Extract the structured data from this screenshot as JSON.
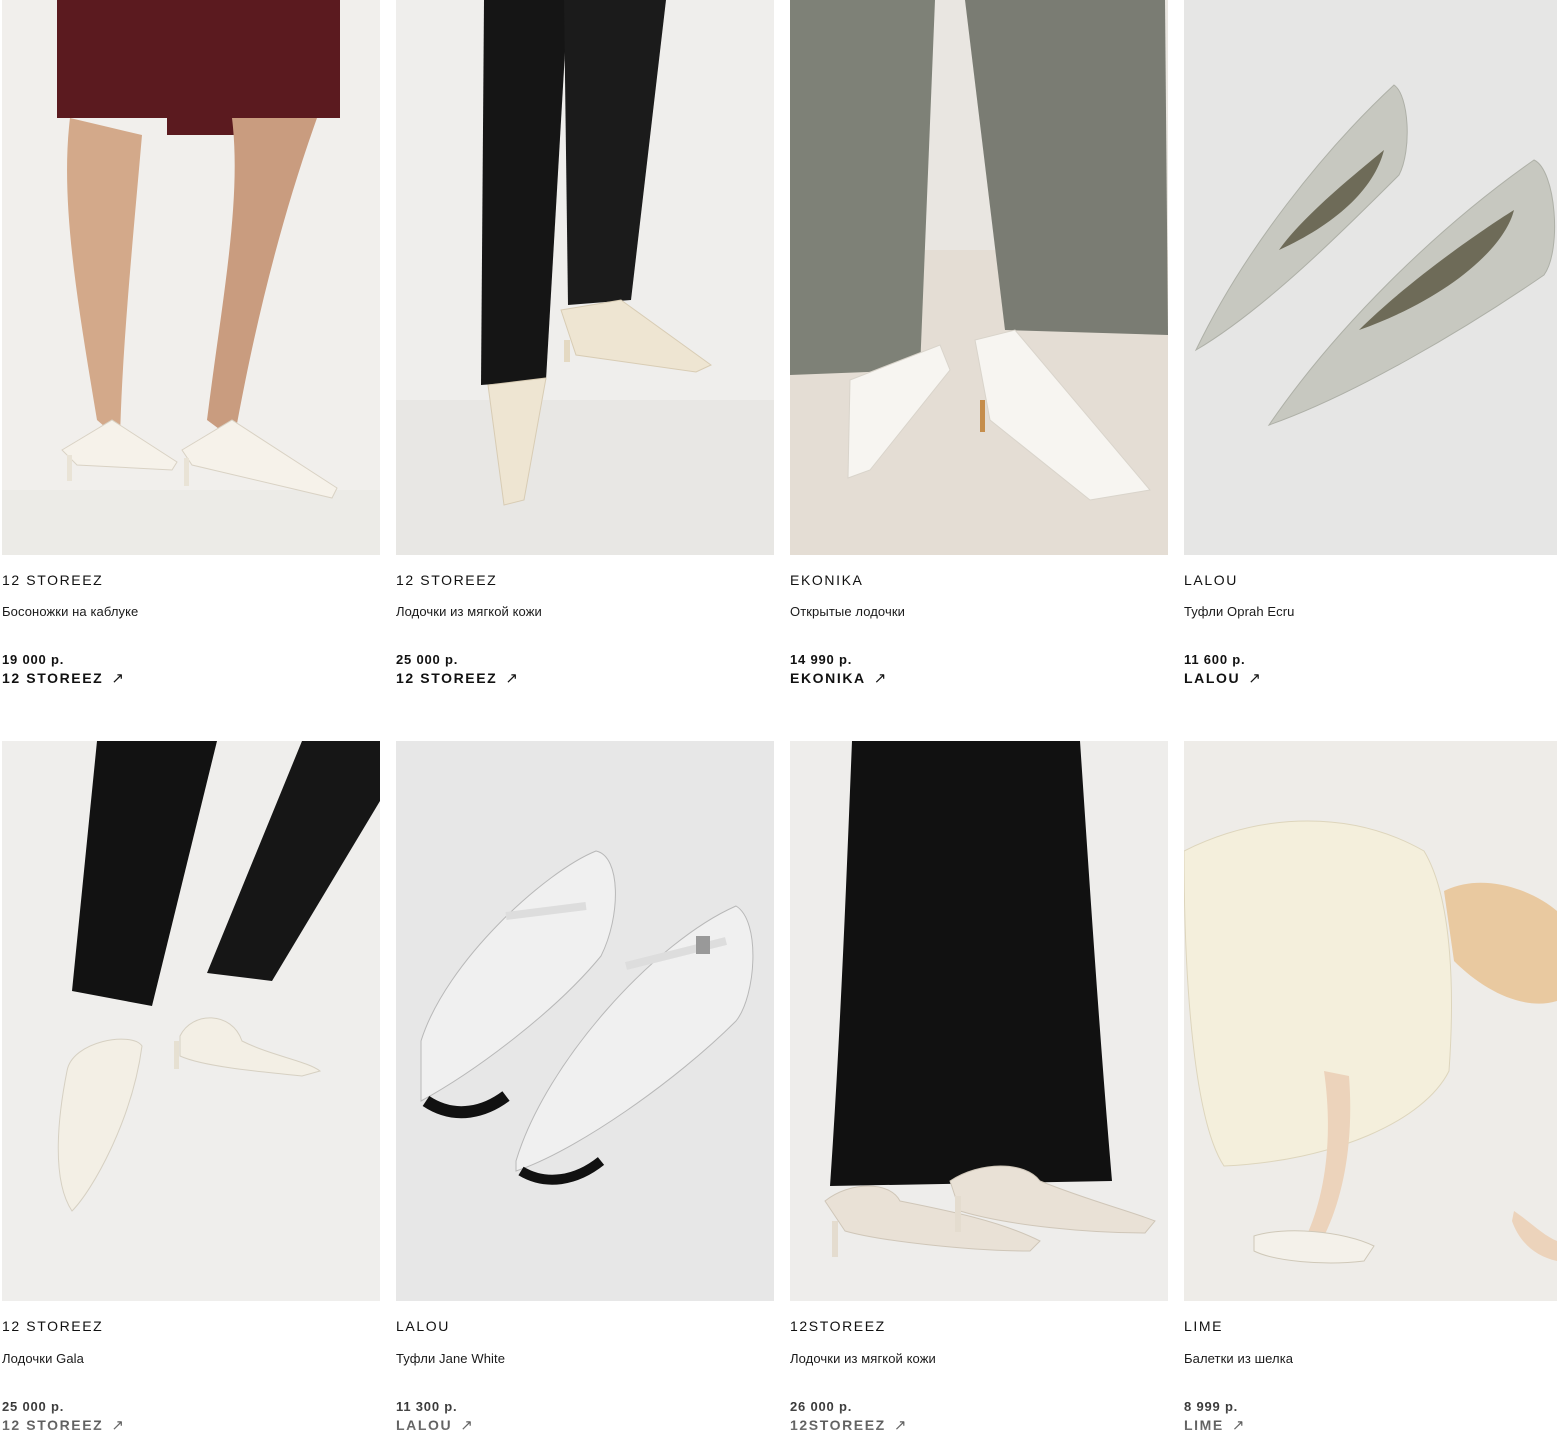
{
  "products": [
    {
      "brand": "12 STOREEZ",
      "title": "Босоножки на каблуке",
      "price": "19 000 р.",
      "store": "12 STOREEZ",
      "image_icon": "strappy-heeled-sandals-photo",
      "bg": "#f0eeeb"
    },
    {
      "brand": "12 STOREEZ",
      "title": "Лодочки из мягкой кожи",
      "price": "25 000 р.",
      "store": "12 STOREEZ",
      "image_icon": "soft-leather-pumps-photo",
      "bg": "#ecebe8"
    },
    {
      "brand": "EKONIKA",
      "title": "Открытые лодочки",
      "price": "14 990 р.",
      "store": "EKONIKA",
      "image_icon": "open-pumps-photo",
      "bg": "#e6e2dc"
    },
    {
      "brand": "LALOU",
      "title": "Туфли Oprah Ecru",
      "price": "11 600 р.",
      "store": "LALOU",
      "image_icon": "pointed-flats-photo",
      "bg": "#e7e7e6"
    },
    {
      "brand": "12 STOREEZ",
      "title": "Лодочки Gala",
      "price": "25 000 р.",
      "store": "12 STOREEZ",
      "image_icon": "pointed-pumps-photo",
      "bg": "#efeeec"
    },
    {
      "brand": "LALOU",
      "title": "Туфли Jane White",
      "price": "11 300 р.",
      "store": "LALOU",
      "image_icon": "mary-jane-flats-photo",
      "bg": "#e8e8e8"
    },
    {
      "brand": "12STOREEZ",
      "title": "Лодочки из мягкой кожи",
      "price": "26 000 р.",
      "store": "12STOREEZ",
      "image_icon": "knit-pumps-photo",
      "bg": "#eeedeb"
    },
    {
      "brand": "LIME",
      "title": "Балетки из шелка",
      "price": "8 999 р.",
      "store": "LIME",
      "image_icon": "silk-ballet-flats-photo",
      "bg": "#eceae6"
    }
  ],
  "link_arrow": "↗"
}
